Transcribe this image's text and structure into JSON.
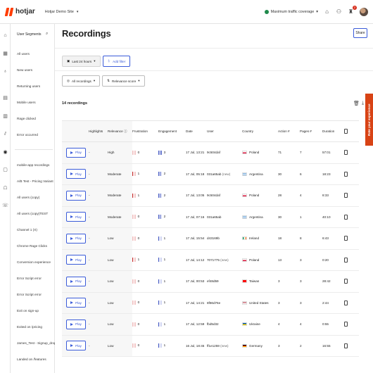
{
  "topbar": {
    "brand": "hotjar",
    "site_name": "Hotjar Demo Site",
    "traffic_label": "Maximum traffic coverage",
    "notifications_count": "2"
  },
  "segments": {
    "header": "User Segments",
    "items": [
      "All users",
      "New users",
      "Returning users",
      "Mobile users",
      "Rage clicked",
      "Error occurred",
      "mobile-app recordings",
      "A/B Test - Pricing Variant",
      "All users (copy)",
      "All users (copy)TEST",
      "Channel 1 (X)",
      "Chrome Rage Clicks",
      "Conversion experience",
      "Error Script error",
      "Error Script error",
      "Exit on sign-up",
      "Exited on /pricing",
      "James_Test - Signup_dropoff",
      "Landed on /features"
    ]
  },
  "main": {
    "title": "Recordings",
    "share_label": "Share",
    "time_filter": "Last 24 hours",
    "add_filter": "Add filter",
    "recordings_select": "All recordings",
    "sort_select": "Relevance score",
    "count_label": "14 recordings"
  },
  "feedback_tab": "Rate your experience",
  "table": {
    "headers": [
      "",
      "Highlights",
      "Relevance",
      "Frustration",
      "Engagement",
      "Date",
      "User",
      "Country",
      "Action #",
      "Pages #",
      "Duration",
      ""
    ],
    "play_label": "Play",
    "rows": [
      {
        "highlights": "-",
        "relevance": "High",
        "frustration": 0,
        "engagement": 3,
        "date": "17 Jul, 13:21",
        "user": "9c504daf",
        "user_new": "",
        "country": "Poland",
        "flag": "pl",
        "actions": "71",
        "pages": "7",
        "duration": "57:01"
      },
      {
        "highlights": "-",
        "relevance": "Moderate",
        "frustration": 1,
        "engagement": 2,
        "date": "17 Jul, 05:18",
        "user": "031a65ab",
        "user_new": "(new)",
        "country": "Argentina",
        "flag": "ar",
        "actions": "30",
        "pages": "6",
        "duration": "18:23"
      },
      {
        "highlights": "-",
        "relevance": "Moderate",
        "frustration": 1,
        "engagement": 2,
        "date": "17 Jul, 13:05",
        "user": "9c504daf",
        "user_new": "",
        "country": "Poland",
        "flag": "pl",
        "actions": "28",
        "pages": "4",
        "duration": "8:33"
      },
      {
        "highlights": "-",
        "relevance": "Moderate",
        "frustration": 0,
        "engagement": 2,
        "date": "17 Jul, 07:16",
        "user": "031a65ab",
        "user_new": "",
        "country": "Argentina",
        "flag": "ar",
        "actions": "30",
        "pages": "1",
        "duration": "40:10"
      },
      {
        "highlights": "-",
        "relevance": "Low",
        "frustration": 0,
        "engagement": 1,
        "date": "17 Jul, 15:54",
        "user": "d43169b",
        "user_new": "",
        "country": "Ireland",
        "flag": "ie",
        "actions": "18",
        "pages": "8",
        "duration": "6:43"
      },
      {
        "highlights": "-",
        "relevance": "Low",
        "frustration": 1,
        "engagement": 1,
        "date": "17 Jul, 14:12",
        "user": "7071775",
        "user_new": "(new)",
        "country": "Poland",
        "flag": "pl",
        "actions": "13",
        "pages": "3",
        "duration": "0:20"
      },
      {
        "highlights": "-",
        "relevance": "Low",
        "frustration": 0,
        "engagement": 1,
        "date": "17 Jul, 00:53",
        "user": "ef48d59",
        "user_new": "",
        "country": "Taiwan",
        "flag": "tw",
        "actions": "3",
        "pages": "3",
        "duration": "28:42"
      },
      {
        "highlights": "-",
        "relevance": "Low",
        "frustration": 0,
        "engagement": 1,
        "date": "17 Jul, 14:21",
        "user": "8f86d76e",
        "user_new": "",
        "country": "United States",
        "flag": "us",
        "actions": "3",
        "pages": "3",
        "duration": "2:44"
      },
      {
        "highlights": "-",
        "relevance": "Low",
        "frustration": 0,
        "engagement": 1,
        "date": "17 Jul, 12:59",
        "user": "fbd5d32",
        "user_new": "",
        "country": "Ukraine",
        "flag": "ua",
        "actions": "4",
        "pages": "4",
        "duration": "0:55"
      },
      {
        "highlights": "-",
        "relevance": "Low",
        "frustration": 0,
        "engagement": 1,
        "date": "16 Jul, 18:45",
        "user": "ff1e1259",
        "user_new": "(new)",
        "country": "Germany",
        "flag": "de",
        "actions": "3",
        "pages": "2",
        "duration": "16:55"
      }
    ]
  },
  "colors": {
    "accent": "#3a5bd9",
    "brand": "#ff3c00",
    "frustration": "#c62828",
    "engagement": "#3a4fbf",
    "feedback": "#d84315"
  }
}
